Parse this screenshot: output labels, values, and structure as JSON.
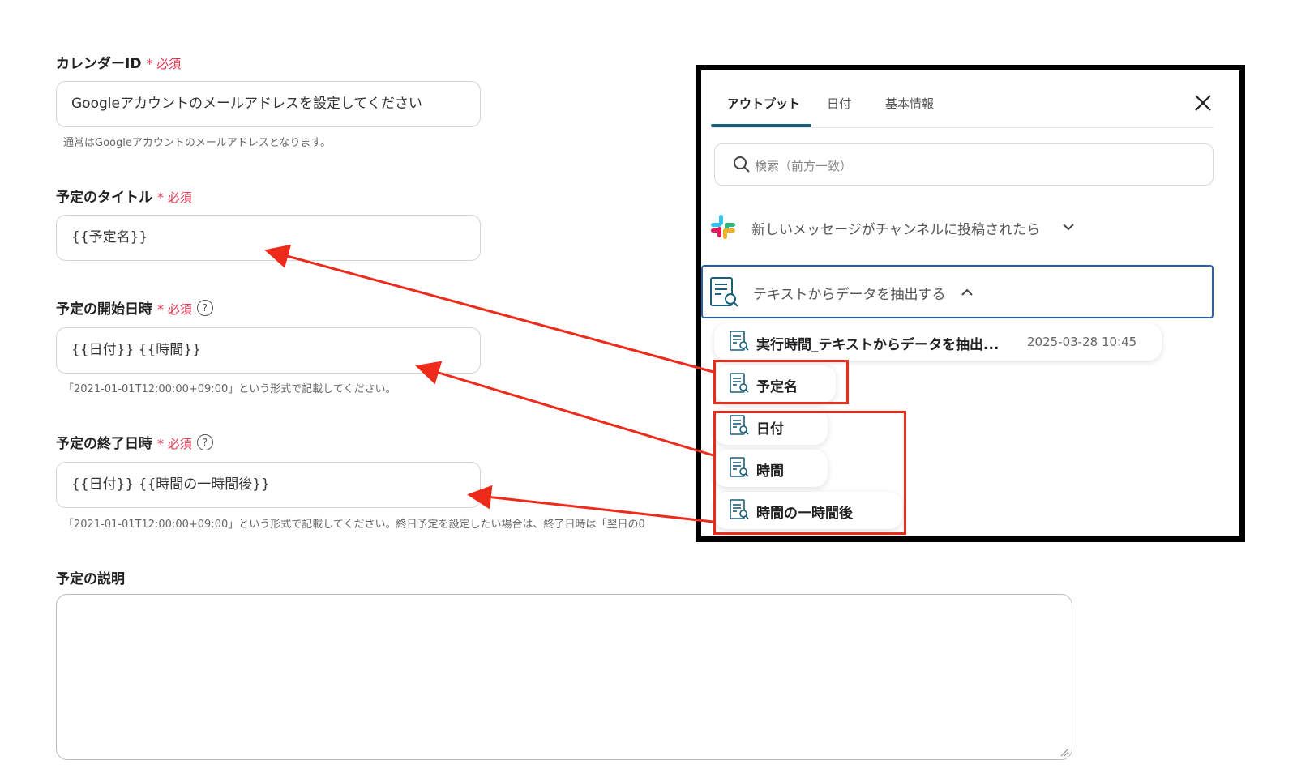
{
  "form": {
    "calendar_id": {
      "label": "カレンダーID",
      "required": "必須",
      "value": "Googleアカウントのメールアドレスを設定してください",
      "hint": "通常はGoogleアカウントのメールアドレスとなります。"
    },
    "title": {
      "label": "予定のタイトル",
      "required": "必須",
      "value": "{{予定名}}"
    },
    "start": {
      "label": "予定の開始日時",
      "required": "必須",
      "value": "{{日付}} {{時間}}",
      "hint": "「2021-01-01T12:00:00+09:00」という形式で記載してください。"
    },
    "end": {
      "label": "予定の終了日時",
      "required": "必須",
      "value": "{{日付}} {{時間の一時間後}}",
      "hint": "「2021-01-01T12:00:00+09:00」という形式で記載してください。終日予定を設定したい場合は、終了日時は「翌日の0"
    },
    "description": {
      "label": "予定の説明",
      "value": ""
    },
    "required_star": "*",
    "help_glyph": "?"
  },
  "panel": {
    "tabs": [
      "アウトプット",
      "日付",
      "基本情報"
    ],
    "active_tab": "アウトプット",
    "search_placeholder": "検索（前方一致）",
    "groups": [
      {
        "label": "新しいメッセージがチャンネルに投稿されたら",
        "icon": "slack-icon",
        "expanded": false
      },
      {
        "label": "テキストからデータを抽出する",
        "icon": "document-search-icon",
        "expanded": true
      }
    ],
    "items": [
      {
        "label": "実行時間_テキストからデータを抽出...",
        "value": "2025-03-28 10:45"
      },
      {
        "label": "予定名"
      },
      {
        "label": "日付"
      },
      {
        "label": "時間"
      },
      {
        "label": "時間の一時間後"
      }
    ]
  },
  "colors": {
    "required": "#e8344e",
    "tab_underline": "#1a5f7a",
    "selected_border": "#2b5fb0",
    "annotation_red": "#ee2a1a"
  }
}
